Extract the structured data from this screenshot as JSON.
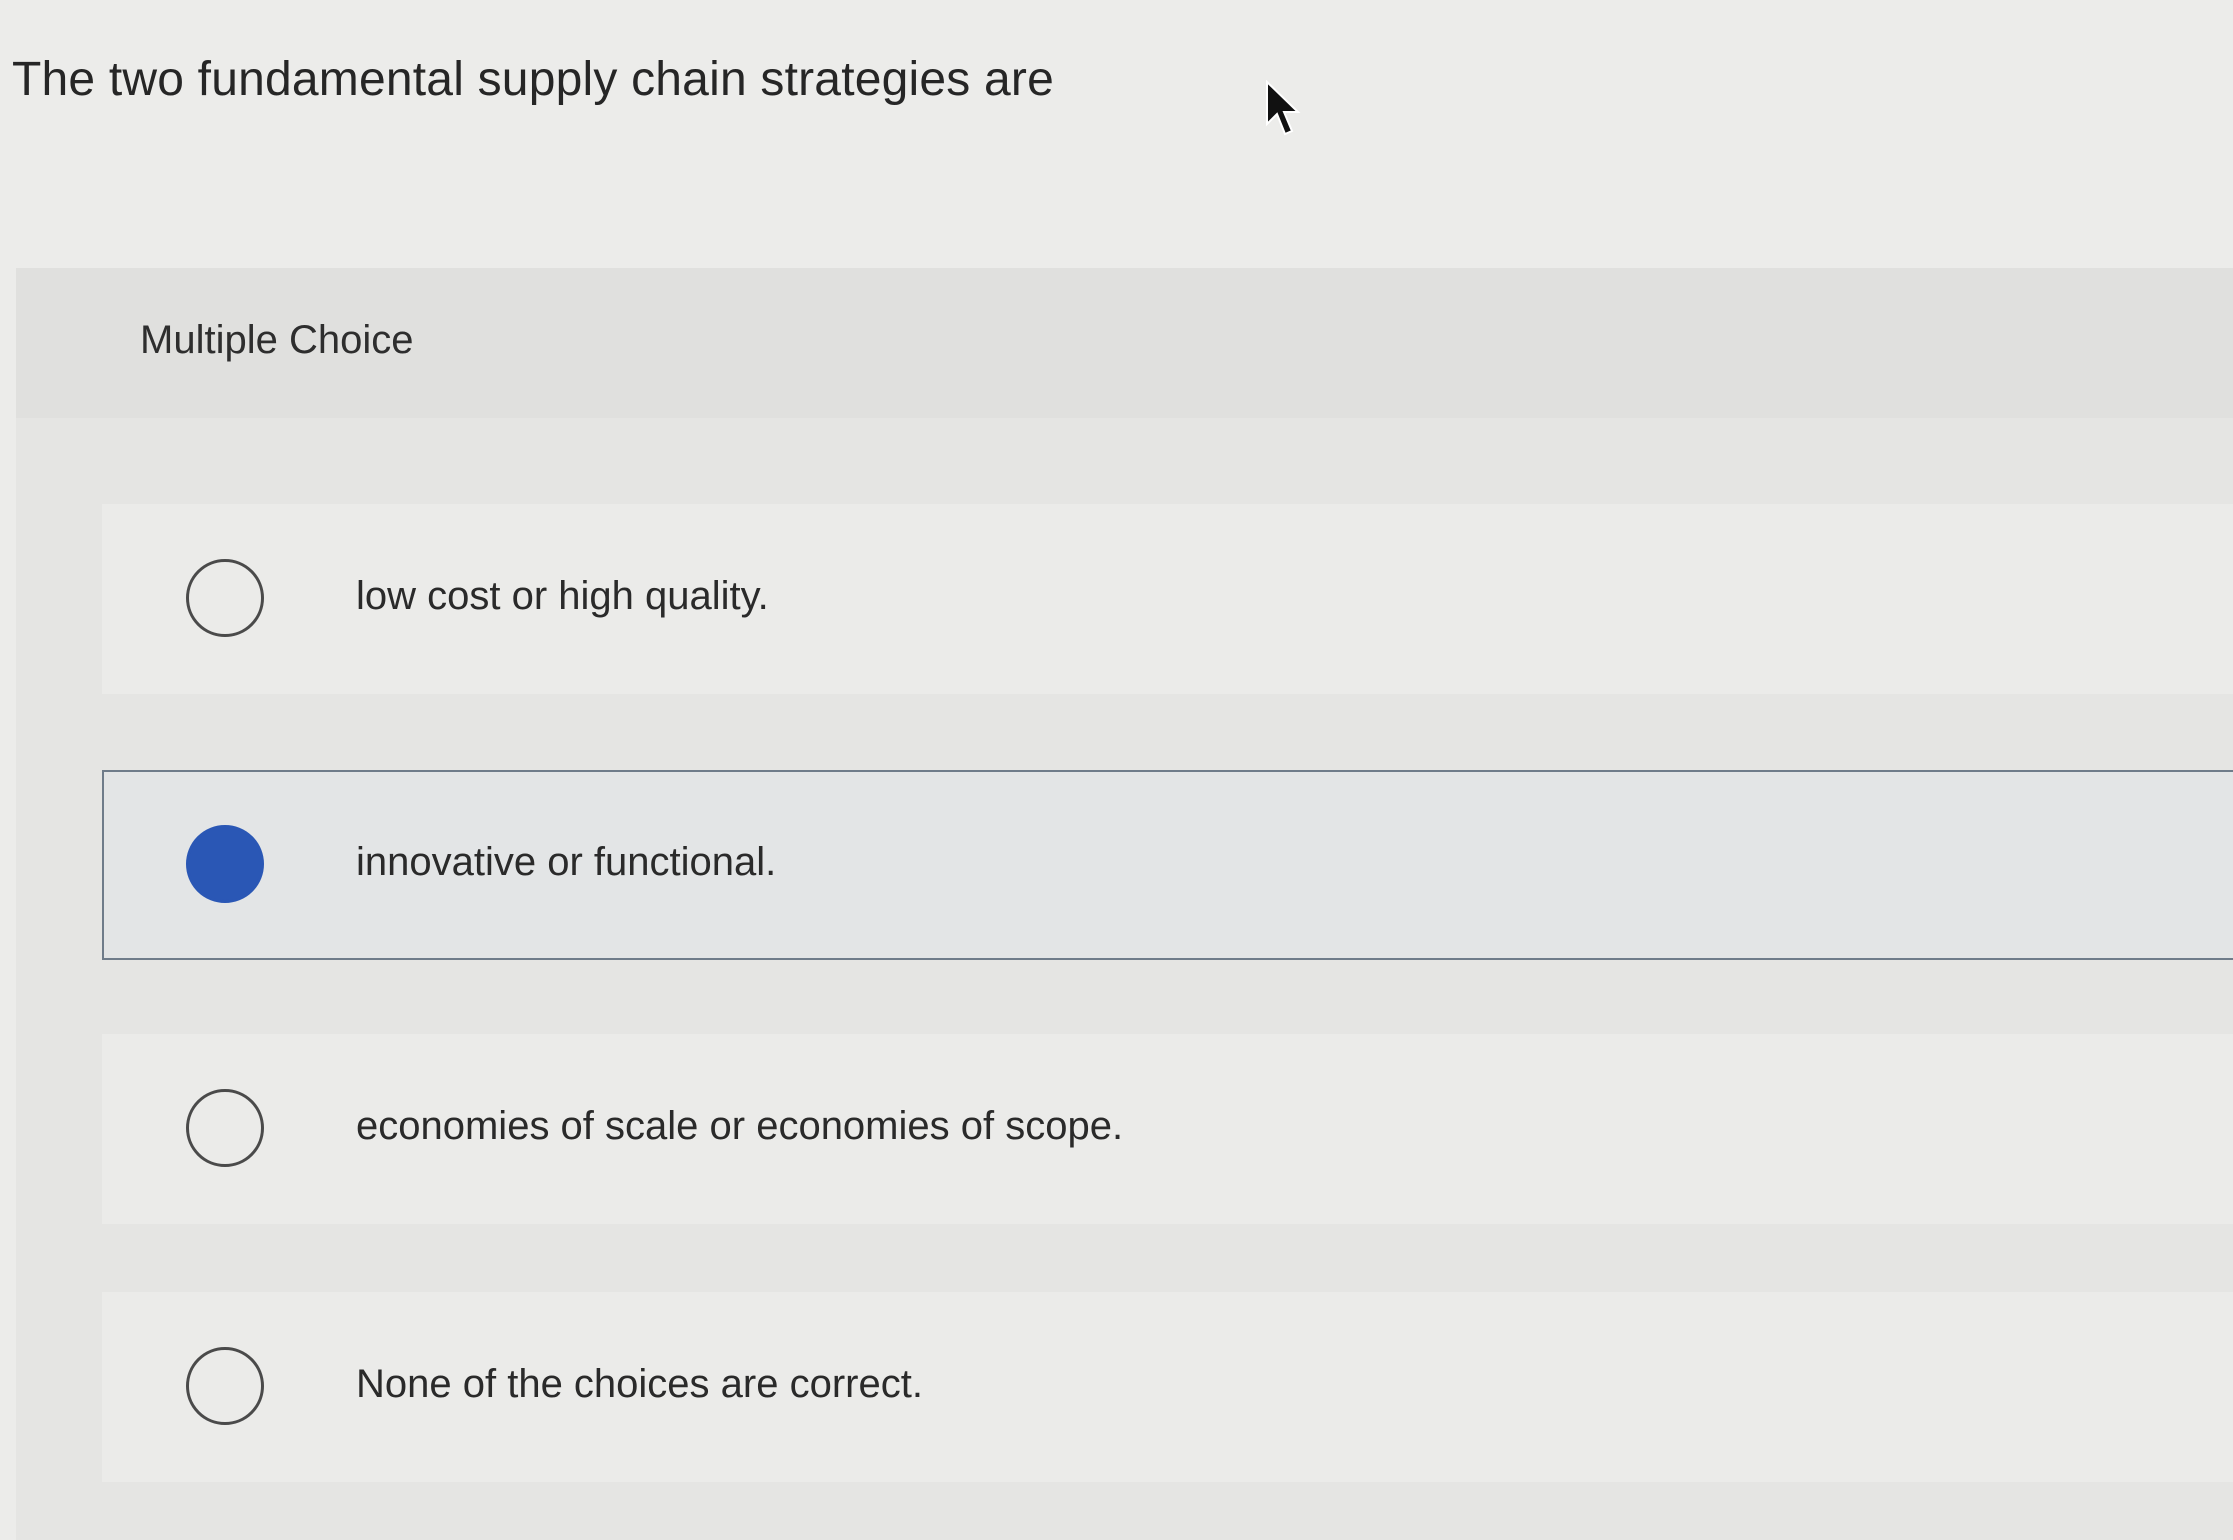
{
  "question": {
    "text": "The two fundamental supply chain strategies are"
  },
  "quiz": {
    "type_label": "Multiple Choice",
    "options": [
      {
        "label": "low cost or high quality.",
        "selected": false
      },
      {
        "label": "innovative or functional.",
        "selected": true
      },
      {
        "label": "economies of scale or economies of scope.",
        "selected": false
      },
      {
        "label": "None of the choices are correct.",
        "selected": false
      }
    ]
  },
  "colors": {
    "selected_radio": "#2a57b5",
    "selected_border": "#6f7c8a",
    "background": "#ececea"
  },
  "icons": {
    "cursor": "mouse-pointer-icon",
    "radio_empty": "radio-unselected-icon",
    "radio_filled": "radio-selected-icon"
  }
}
